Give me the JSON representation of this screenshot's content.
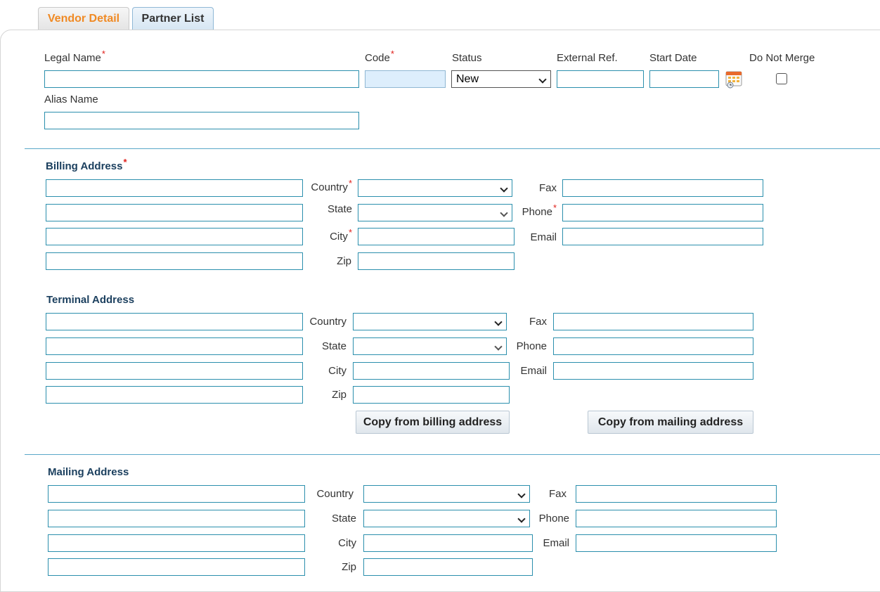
{
  "tabs": {
    "vendor_detail": "Vendor Detail",
    "partner_list": "Partner List"
  },
  "top": {
    "legal_name_label": "Legal Name",
    "code_label": "Code",
    "status_label": "Status",
    "status_value": "New",
    "external_ref_label": "External Ref.",
    "start_date_label": "Start Date",
    "do_not_merge_label": "Do Not Merge",
    "alias_name_label": "Alias Name",
    "required_mark": "*"
  },
  "billing": {
    "title": "Billing Address",
    "country": "Country",
    "state": "State",
    "city": "City",
    "zip": "Zip",
    "fax": "Fax",
    "phone": "Phone",
    "email": "Email"
  },
  "terminal": {
    "title": "Terminal Address",
    "country": "Country",
    "state": "State",
    "city": "City",
    "zip": "Zip",
    "fax": "Fax",
    "phone": "Phone",
    "email": "Email",
    "copy_billing": "Copy from billing address",
    "copy_mailing": "Copy from mailing address"
  },
  "mailing": {
    "title": "Mailing Address",
    "country": "Country",
    "state": "State",
    "city": "City",
    "zip": "Zip",
    "fax": "Fax",
    "phone": "Phone",
    "email": "Email"
  },
  "icons": {
    "calendar": "calendar-icon",
    "chevron": "chevron-down-icon"
  },
  "colors": {
    "tab_active_text": "#f08a24",
    "input_border": "#2b8fad",
    "required": "#e0201b",
    "section_title": "#1b3f5e"
  }
}
